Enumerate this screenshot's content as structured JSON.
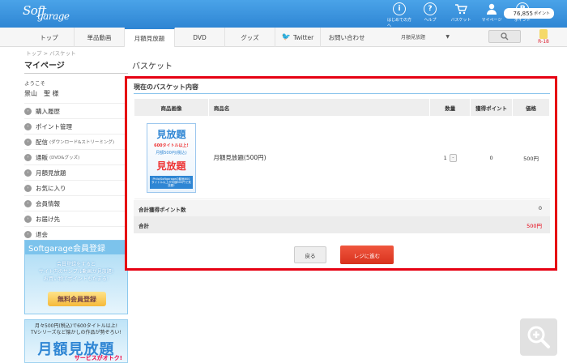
{
  "header": {
    "logo_text": "Soft",
    "logo_text2": "garage",
    "icons": [
      {
        "label": "はじめての方へ",
        "icon": "info-icon",
        "glyph": "i"
      },
      {
        "label": "ヘルプ",
        "icon": "help-icon",
        "glyph": "?"
      },
      {
        "label": "バスケット",
        "icon": "cart-icon",
        "glyph": "🛒"
      },
      {
        "label": "マイページ",
        "icon": "user-icon",
        "glyph": "👤"
      },
      {
        "label": "ポイント",
        "icon": "point-icon",
        "glyph": "P"
      }
    ],
    "points_value": "76,855",
    "points_unit": "ポイント"
  },
  "nav": {
    "items": [
      "トップ",
      "単品動画",
      "月額見放題",
      "DVD",
      "グッズ",
      "Twitter",
      "お問い合わせ"
    ],
    "active_index": 2,
    "select_value": "月額見放題",
    "r18_label": "R-18"
  },
  "breadcrumb": "トップ > バスケット",
  "sidebar": {
    "title": "マイページ",
    "welcome": "ようこそ",
    "user_name": "景山　聖 様",
    "items": [
      {
        "label": "購入履歴",
        "note": ""
      },
      {
        "label": "ポイント管理",
        "note": ""
      },
      {
        "label": "配信",
        "note": "(ダウンロード&ストリーミング)"
      },
      {
        "label": "通販",
        "note": "(DVD&グッズ)"
      },
      {
        "label": "月額見放題",
        "note": ""
      },
      {
        "label": "お気に入り",
        "note": ""
      },
      {
        "label": "会員情報",
        "note": ""
      },
      {
        "label": "お届け先",
        "note": ""
      },
      {
        "label": "退会",
        "note": ""
      }
    ],
    "banner1": {
      "title": "Softgarage会員登録",
      "line1": "会員登録をすると",
      "line2": "サイト内のサンプル動画が見放題!",
      "line3": "お買い物でポイントもたまる!",
      "button": "無料会員登録"
    },
    "banner2": {
      "line1": "月々500円(税込)で600タイトル以上!",
      "line2": "TVシリーズなど懐かしの作品が勢ぞろい!",
      "big": "月額見放題",
      "sub": "サービスがオトク!"
    }
  },
  "main": {
    "page_title": "バスケット",
    "section_title": "現在のバスケット内容",
    "columns": [
      "商品画像",
      "商品名",
      "数量",
      "獲得ポイント",
      "価格"
    ],
    "rows": [
      {
        "image": {
          "t1": "見放題",
          "t2": "600タイトル以上!",
          "t3": "月額500円(税込)",
          "t4": "見放題",
          "t5": "Philo/Softgarageの動画600タイトル以上が月額500円で見放題!"
        },
        "name": "月額見放題(500円)",
        "qty": "1",
        "minus": "-",
        "points": "0",
        "price": "500円"
      }
    ],
    "total_points_label": "合計獲得ポイント数",
    "total_points_value": "0",
    "total_label": "合計",
    "total_value": "500円",
    "back_button": "戻る",
    "checkout_button": "レジに進む"
  }
}
